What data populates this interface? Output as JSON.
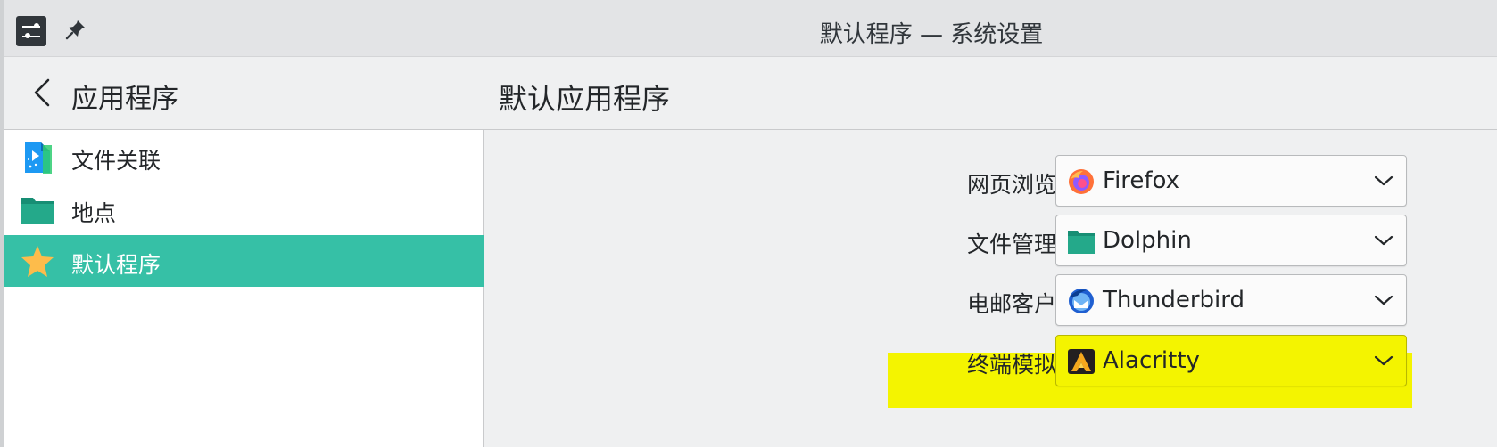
{
  "window": {
    "title": "默认程序 — 系统设置"
  },
  "titlebar": {
    "app_icon": "system-settings-icon",
    "pin_icon": "pin-icon"
  },
  "sidebar": {
    "title": "应用程序",
    "back_icon": "chevron-left-icon",
    "items": [
      {
        "label": "文件关联",
        "icon": "file-associations-icon",
        "active": false
      },
      {
        "label": "地点",
        "icon": "folder-icon",
        "active": false
      },
      {
        "label": "默认程序",
        "icon": "star-icon",
        "active": true
      }
    ]
  },
  "main": {
    "title": "默认应用程序",
    "rows": [
      {
        "label": "网页浏览器：",
        "value": "Firefox",
        "icon": "firefox-icon"
      },
      {
        "label": "文件管理器：",
        "value": "Dolphin",
        "icon": "dolphin-folder-icon"
      },
      {
        "label": "电邮客户端：",
        "value": "Thunderbird",
        "icon": "thunderbird-icon"
      },
      {
        "label": "终端模拟器：",
        "value": "Alacritty",
        "icon": "alacritty-icon",
        "highlighted": true
      }
    ]
  },
  "colors": {
    "accent": "#36c0a6",
    "highlight": "#f4f400",
    "sidebar_bg": "#ffffff",
    "main_bg": "#eff0f1"
  }
}
